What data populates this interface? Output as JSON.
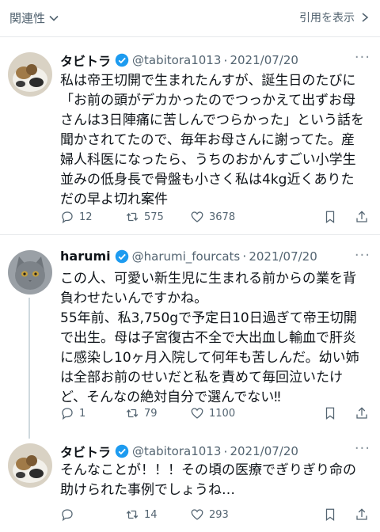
{
  "topbar": {
    "related_label": "関連性",
    "quote_label": "引用を表示"
  },
  "tweets": [
    {
      "name": "タビトラ",
      "handle": "@tabitora1013",
      "date": "2021/07/20",
      "lines": [
        "私は帝王切開で生まれたんすが、誕生日のたびに",
        "「お前の頭がデカかったのでつっかえて出ずお母",
        "さんは3日陣痛に苦しんでつらかった」という話を",
        "聞かされてたので、毎年お母さんに謝ってた。産",
        "婦人科医になったら、うちのおかんすごい小学生",
        "並みの低身長で骨盤も小さく私は4kg近くありた",
        "だの早よ切れ案件"
      ],
      "replies": "12",
      "retweets": "575",
      "likes": "3678"
    },
    {
      "name": "harumi",
      "handle": "@harumi_fourcats",
      "date": "2021/07/20",
      "lines": [
        "この人、可愛い新生児に生まれる前からの業を背",
        "負わせたいんですかね。",
        "55年前、私3,750gで予定日10日過ぎて帝王切開",
        "で出生。母は子宮復古不全で大出血し輸血で肝炎",
        "に感染し10ヶ月入院して何年も苦しんだ。幼い姉",
        "は全部お前のせいだと私を責めて毎回泣いたけ",
        "ど、そんなの絶対自分で選んでない‼"
      ],
      "replies": "1",
      "retweets": "79",
      "likes": "1100"
    },
    {
      "name": "タビトラ",
      "handle": "@tabitora1013",
      "date": "2021/07/20",
      "lines": [
        "そんなことが！！！その頃の医療でぎりぎり命の",
        "助けられた事例でしょうね…"
      ],
      "replies": "",
      "retweets": "14",
      "likes": "293"
    }
  ],
  "colors": {
    "verified": "#1d9bf0",
    "muted": "#536471",
    "text": "#0f1419",
    "alert": "#e0245e"
  },
  "icons": [
    "chevron-down-icon",
    "chevron-right-icon",
    "verified-badge-icon",
    "more-icon",
    "reply-icon",
    "retweet-icon",
    "like-icon",
    "bookmark-icon",
    "share-icon"
  ]
}
